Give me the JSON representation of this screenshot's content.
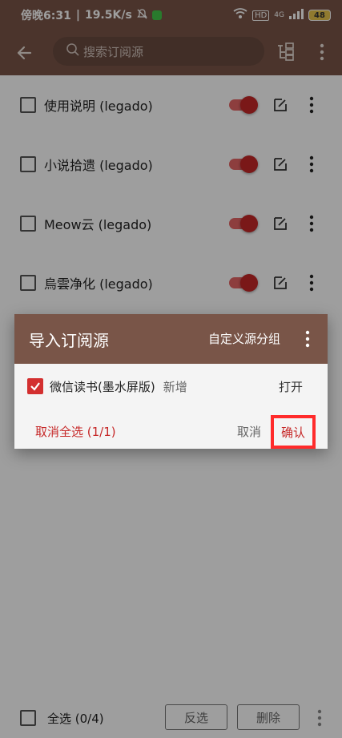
{
  "status_bar": {
    "time": "傍晚6:31",
    "speed": "19.5K/s",
    "network": "4G",
    "battery": "48"
  },
  "app_bar": {
    "search_placeholder": "搜索订阅源"
  },
  "list": {
    "items": [
      {
        "label": "使用说明 (legado)",
        "enabled": true
      },
      {
        "label": "小说拾遗 (legado)",
        "enabled": true
      },
      {
        "label": "Meow云 (legado)",
        "enabled": true
      },
      {
        "label": "烏雲净化 (legado)",
        "enabled": true
      }
    ]
  },
  "bottom_bar": {
    "select_all": "全选 (0/4)",
    "invert": "反选",
    "delete": "删除"
  },
  "dialog": {
    "title": "导入订阅源",
    "custom_group": "自定义源分组",
    "item": {
      "name": "微信读书(墨水屏版)",
      "status": "新增",
      "open": "打开",
      "checked": true
    },
    "deselect_all": "取消全选 (1/1)",
    "cancel": "取消",
    "confirm": "确认"
  },
  "colors": {
    "primary": "#795548",
    "accent": "#c62828",
    "highlight_box": "#ff2b2b"
  }
}
